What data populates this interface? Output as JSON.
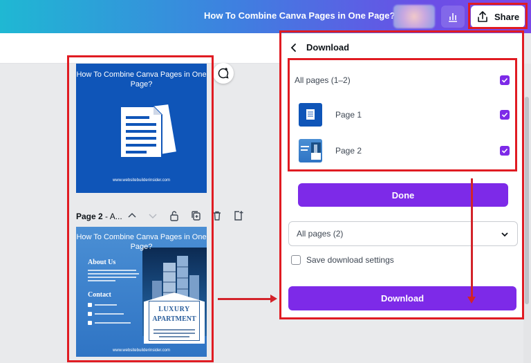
{
  "topbar": {
    "doc_title": "How To Combine Canva Pages in One Page?",
    "share_label": "Share"
  },
  "canvas": {
    "page1": {
      "title": "How To Combine Canva Pages in One Page?",
      "url": "www.websitebuilderinsider.com"
    },
    "page2_bar": {
      "label_bold": "Page 2",
      "label_rest": " - A..."
    },
    "page2": {
      "title": "How To Combine Canva Pages in One Page?",
      "about": "About Us",
      "contact": "Contact",
      "luxury": "LUXURY",
      "apartment": "APARTMENT",
      "url": "www.websitebuilderinsider.com"
    }
  },
  "panel": {
    "title": "Download",
    "all_pages_label": "All pages (1–2)",
    "pages": [
      {
        "label": "Page 1",
        "checked": true
      },
      {
        "label": "Page 2",
        "checked": true
      }
    ],
    "done_label": "Done",
    "select_value": "All pages (2)",
    "save_settings_label": "Save download settings",
    "download_label": "Download"
  },
  "colors": {
    "accent": "#7d2ae8",
    "highlight": "#e01b22"
  }
}
